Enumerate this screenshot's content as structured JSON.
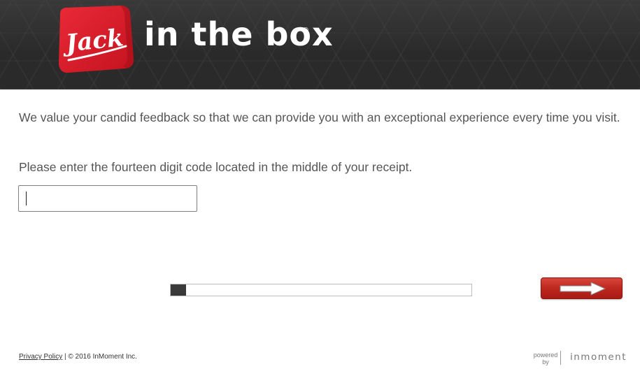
{
  "header": {
    "logo": {
      "box_text": "Jack",
      "wordmark": "in the box",
      "registered_mark": "®"
    },
    "colors": {
      "background": "#2a2a2a",
      "brand_red": "#e0202e"
    }
  },
  "main": {
    "intro_text": "We value your candid feedback so that we can provide you with an exceptional experience every time you visit.",
    "code_prompt": "Please enter the fourteen digit code located in the middle of your receipt.",
    "code_input": {
      "value": "",
      "placeholder": ""
    }
  },
  "progress": {
    "percent": 5,
    "fill_color": "#3a3a3a"
  },
  "next_button": {
    "icon": "right-arrow-icon",
    "color": "#c02a21"
  },
  "footer": {
    "privacy_link": "Privacy Policy",
    "copyright": "| © 2016 InMoment Inc.",
    "powered_by_line1": "powered",
    "powered_by_line2": "by",
    "brand": "inmoment"
  }
}
